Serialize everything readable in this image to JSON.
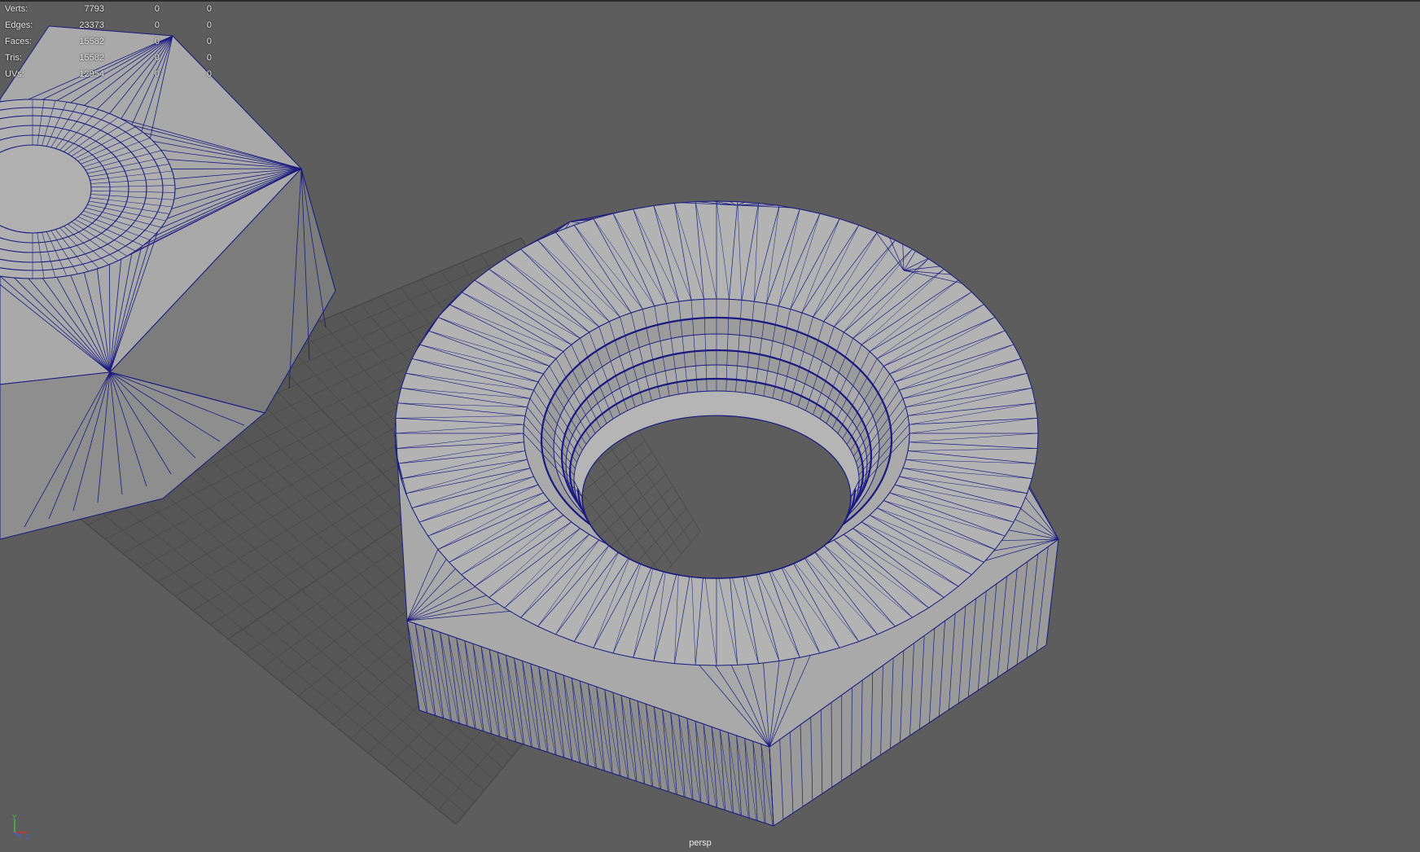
{
  "hud": {
    "rows": [
      {
        "label": "Verts:",
        "c1": "7793",
        "c2": "0",
        "c3": "0"
      },
      {
        "label": "Edges:",
        "c1": "23373",
        "c2": "0",
        "c3": "0"
      },
      {
        "label": "Faces:",
        "c1": "15582",
        "c2": "0",
        "c3": "0"
      },
      {
        "label": "Tris:",
        "c1": "15582",
        "c2": "0",
        "c3": "0"
      },
      {
        "label": "UVs:",
        "c1": "12954",
        "c2": "0",
        "c3": "0"
      }
    ]
  },
  "camera": {
    "label": "persp"
  },
  "axis": {
    "y": "Y",
    "z": "Z"
  },
  "colors": {
    "background": "#5d5d5d",
    "wire": "#1a1a80",
    "surface_top": "#a9a9a9",
    "surface_side": "#8e8e8e",
    "grid": "#4a4a4a",
    "axis_x": "#d03030",
    "axis_y": "#40c040",
    "axis_z": "#4060e0"
  },
  "icons": {
    "axis": "axis-gizmo-icon"
  }
}
